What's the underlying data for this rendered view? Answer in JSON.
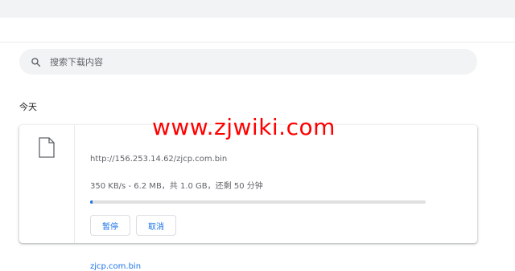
{
  "search": {
    "placeholder": "搜索下载内容"
  },
  "section": {
    "title": "今天"
  },
  "download": {
    "filename": "zjcp.com.bin",
    "url": "http://156.253.14.62/zjcp.com.bin",
    "status": "350 KB/s - 6.2 MB，共 1.0 GB，还剩 50 分钟",
    "progress_fraction": 0.006,
    "pause_label": "暂停",
    "cancel_label": "取消"
  },
  "watermark": {
    "text": "www.zjwiki.com"
  },
  "colors": {
    "accent": "#1a73e8",
    "watermark": "#ff0000",
    "muted_text": "#5f6368"
  }
}
